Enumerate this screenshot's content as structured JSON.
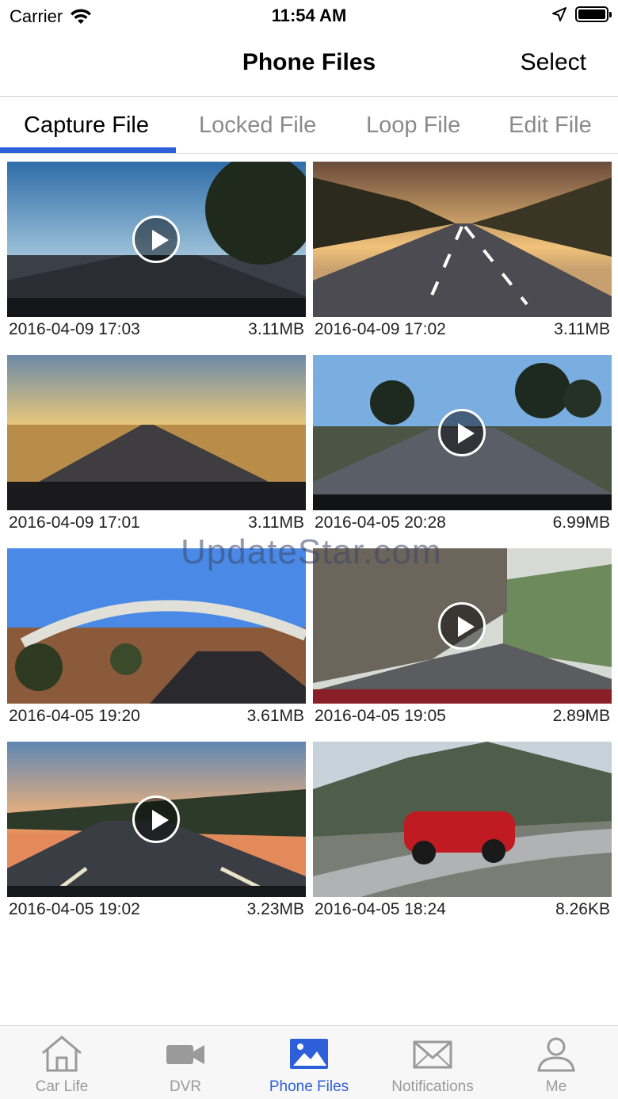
{
  "status_bar": {
    "carrier": "Carrier",
    "time": "11:54 AM"
  },
  "nav": {
    "title": "Phone Files",
    "select_label": "Select"
  },
  "tabs": [
    {
      "label": "Capture File"
    },
    {
      "label": "Locked File"
    },
    {
      "label": "Loop File"
    },
    {
      "label": "Edit File"
    }
  ],
  "files": [
    {
      "date": "2016-04-09 17:03",
      "size": "3.11MB",
      "video": true
    },
    {
      "date": "2016-04-09 17:02",
      "size": "3.11MB",
      "video": false
    },
    {
      "date": "2016-04-09 17:01",
      "size": "3.11MB",
      "video": false
    },
    {
      "date": "2016-04-05 20:28",
      "size": "6.99MB",
      "video": true
    },
    {
      "date": "2016-04-05 19:20",
      "size": "3.61MB",
      "video": false
    },
    {
      "date": "2016-04-05 19:05",
      "size": "2.89MB",
      "video": true
    },
    {
      "date": "2016-04-05 19:02",
      "size": "3.23MB",
      "video": true
    },
    {
      "date": "2016-04-05 18:24",
      "size": "8.26KB",
      "video": false
    }
  ],
  "watermark": "UpdateStar.com",
  "tabbar": [
    {
      "label": "Car Life",
      "icon": "house-icon"
    },
    {
      "label": "DVR",
      "icon": "video-camera-icon"
    },
    {
      "label": "Phone Files",
      "icon": "photo-icon"
    },
    {
      "label": "Notifications",
      "icon": "envelope-icon"
    },
    {
      "label": "Me",
      "icon": "person-icon"
    }
  ],
  "colors": {
    "accent": "#2c5fd9",
    "inactive": "#9a9a9a"
  }
}
